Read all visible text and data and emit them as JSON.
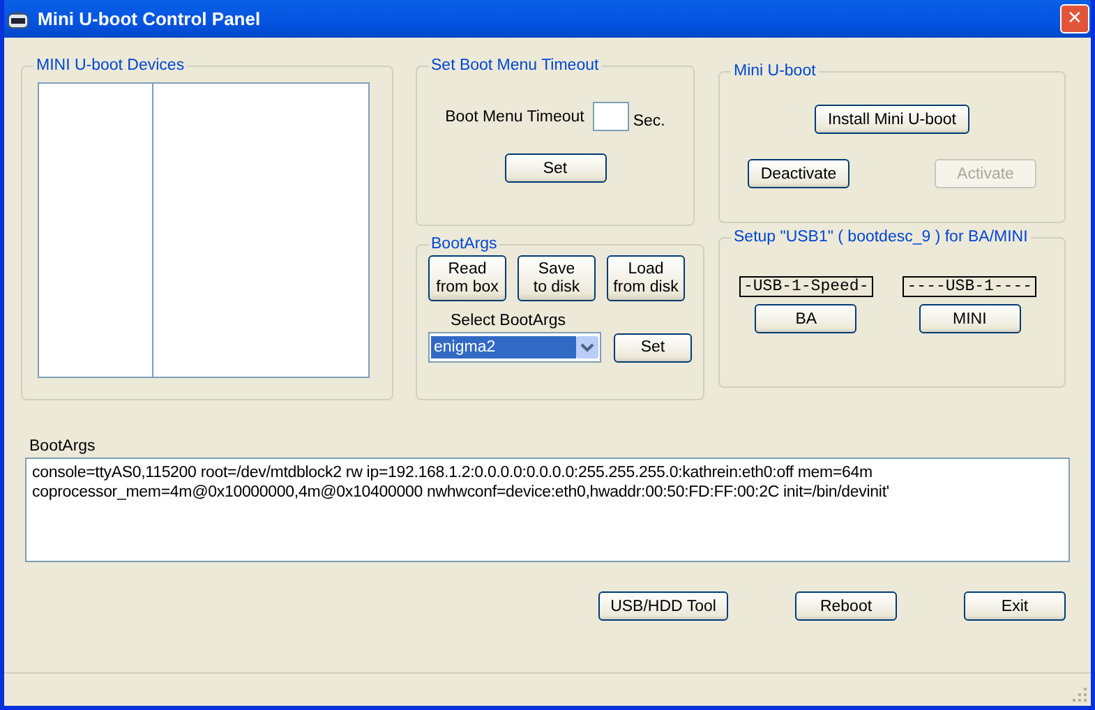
{
  "window": {
    "title": "Mini U-boot Control Panel",
    "close": "✕"
  },
  "devices": {
    "title": "MINI U-boot Devices"
  },
  "timeout": {
    "title": "Set Boot Menu Timeout",
    "label": "Boot Menu Timeout",
    "unit": "Sec.",
    "button": "Set"
  },
  "miniuboot": {
    "title": "Mini U-boot",
    "buttons": [
      {
        "label": "Install Mini U-boot",
        "disabled": false
      },
      {
        "label": "Deactivate",
        "disabled": false
      },
      {
        "label": "Activate",
        "disabled": true
      }
    ]
  },
  "bootargs_group": {
    "title": "BootArgs",
    "buttons": [
      "Read\nfrom box",
      "Save\nto disk",
      "Load\nfrom disk"
    ],
    "select_label": "Select BootArgs",
    "select_value": "enigma2",
    "set_button": "Set"
  },
  "usb": {
    "title": "Setup \"USB1\" ( bootdesc_9 ) for BA/MINI",
    "items": [
      {
        "tag": "-USB-1-Speed-",
        "button": "BA"
      },
      {
        "tag": "----USB-1----",
        "button": "MINI"
      }
    ]
  },
  "bootargs": {
    "label": "BootArgs",
    "lines": [
      "console=ttyAS0,115200 root=/dev/mtdblock2 rw ip=192.168.1.2:0.0.0.0:0.0.0.0:255.255.255.0:kathrein:eth0:off mem=64m",
      "coprocessor_mem=4m@0x10000000,4m@0x10400000 nwhwconf=device:eth0,hwaddr:00:50:FD:FF:00:2C init=/bin/devinit'"
    ]
  },
  "footer_buttons": [
    "USB/HDD Tool",
    "Reboot",
    "Exit"
  ]
}
